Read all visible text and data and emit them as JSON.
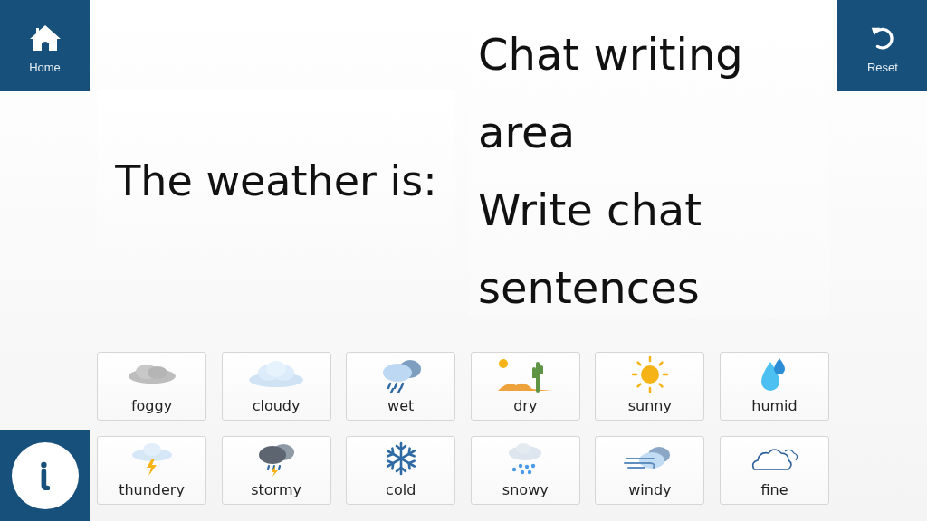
{
  "home_button": {
    "label": "Home"
  },
  "reset_button": {
    "label": "Reset"
  },
  "prompt": {
    "text": "The weather is:"
  },
  "chat_area": {
    "lines": [
      "Chat writing area",
      "Write chat sentences"
    ]
  },
  "tiles": [
    {
      "label": "foggy",
      "kind": "fog"
    },
    {
      "label": "cloudy",
      "kind": "cloud"
    },
    {
      "label": "wet",
      "kind": "rain"
    },
    {
      "label": "dry",
      "kind": "desert"
    },
    {
      "label": "sunny",
      "kind": "sun"
    },
    {
      "label": "humid",
      "kind": "drops"
    },
    {
      "label": "thundery",
      "kind": "thunder"
    },
    {
      "label": "stormy",
      "kind": "storm"
    },
    {
      "label": "cold",
      "kind": "snowflake"
    },
    {
      "label": "snowy",
      "kind": "snow"
    },
    {
      "label": "windy",
      "kind": "wind"
    },
    {
      "label": "fine",
      "kind": "outline"
    }
  ]
}
